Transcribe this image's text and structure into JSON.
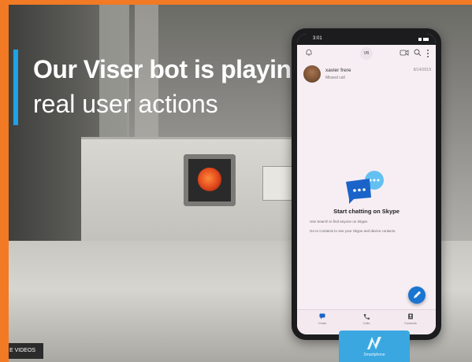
{
  "headline": {
    "line1": "Our Viser bot is playing",
    "line2": "real user actions"
  },
  "colors": {
    "accent_bar": "#1fa3e6",
    "frame_border": "#f27a24",
    "skype_fab": "#1a75d1"
  },
  "phone": {
    "status_time": "3:01",
    "appbar": {
      "avatar_initials": "VB",
      "icons": [
        "bell-icon",
        "video-call-icon",
        "search-icon",
        "more-icon"
      ]
    },
    "chat": {
      "name": "xavier frere",
      "subtitle": "Missed call",
      "date": "8/14/2019"
    },
    "empty_state": {
      "title": "Start chatting on Skype",
      "tip1": "Use Search to find anyone on Skype.",
      "tip2": "Go to Contacts to see your Skype and device contacts."
    },
    "nav": [
      {
        "label": "Chats",
        "icon": "chat-icon"
      },
      {
        "label": "Calls",
        "icon": "phone-icon"
      },
      {
        "label": "Contacts",
        "icon": "contacts-icon"
      }
    ]
  },
  "stand": {
    "label": "Smartphone"
  },
  "badge": {
    "label": "E VIDEOS"
  }
}
